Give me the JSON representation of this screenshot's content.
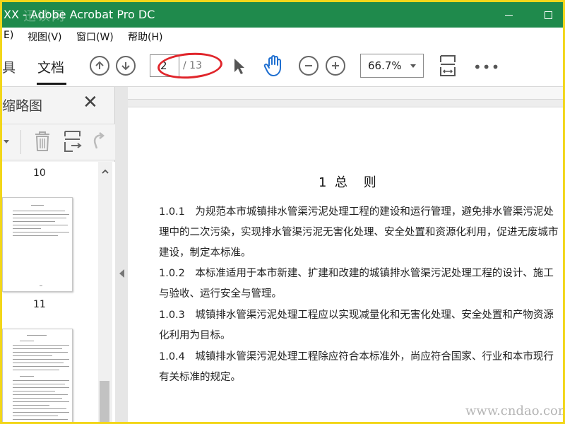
{
  "window": {
    "title": "XX - Adobe Acrobat Pro DC",
    "watermark_logo": "迅读网"
  },
  "menu": {
    "items": [
      {
        "label": "E)"
      },
      {
        "label": "视图(V)"
      },
      {
        "label": "窗口(W)"
      },
      {
        "label": "帮助(H)"
      }
    ]
  },
  "toolbar": {
    "tools_tab": "具",
    "document_tab": "文档",
    "current_page": "2",
    "total_pages": "/ 13",
    "zoom": "66.7%",
    "more": "•••"
  },
  "left_panel": {
    "title": "缩略图",
    "thumbnails": [
      {
        "label": "10"
      },
      {
        "label": "11"
      }
    ]
  },
  "document": {
    "heading": "1  总    则",
    "paragraphs": [
      "1.0.1　为规范本市城镇排水管渠污泥处理工程的建设和运行管理，避免排水管渠污泥处理中的二次污染，实现排水管渠污泥无害化处理、安全处置和资源化利用，促进无废城市建设，制定本标准。",
      "1.0.2　本标准适用于本市新建、扩建和改建的城镇排水管渠污泥处理工程的设计、施工与验收、运行安全与管理。",
      "1.0.3　城镇排水管渠污泥处理工程应以实现减量化和无害化处理、安全处置和产物资源化利用为目标。",
      "1.0.4　城镇排水管渠污泥处理工程除应符合本标准外，尚应符合国家、行业和本市现行有关标准的规定。"
    ]
  },
  "site_watermark": "www.cndao.com",
  "colors": {
    "titlebar": "#1f8a4c",
    "frame_border": "#f2d61a",
    "annotation_circle": "#e0252b"
  }
}
